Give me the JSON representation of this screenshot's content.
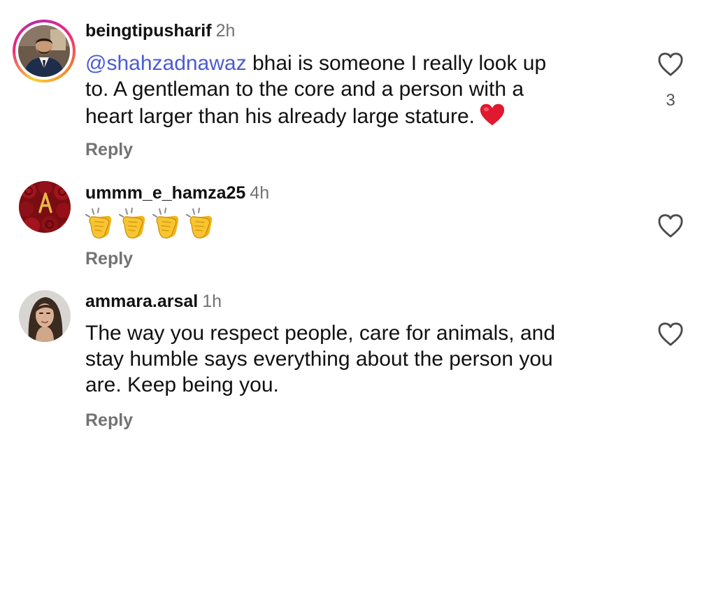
{
  "comments": [
    {
      "username": "beingtipusharif",
      "time": "2h",
      "mention": "@shahzadnawaz",
      "text_lines": [
        " bhai is someone I really look up",
        "to. A gentleman to the core and a person with a",
        "heart larger than his already large stature."
      ],
      "trailing_emoji": "red-heart",
      "reply_label": "Reply",
      "like_count": "3",
      "has_story_ring": true
    },
    {
      "username": "ummm_e_hamza25",
      "time": "4h",
      "emoji": [
        "clapping-hands",
        "clapping-hands",
        "clapping-hands",
        "clapping-hands"
      ],
      "reply_label": "Reply"
    },
    {
      "username": "ammara.arsal",
      "time": "1h",
      "text_lines": [
        "The way you respect people, care for animals, and",
        "stay humble says everything about the person you",
        "are. Keep being you."
      ],
      "reply_label": "Reply"
    }
  ],
  "icons": {
    "like": "heart-outline-icon",
    "heart_emoji_color": "#e0192e",
    "clap_emoji_color": "#f7c531"
  },
  "colors": {
    "text": "#111111",
    "secondary": "#737373",
    "mention": "#4a5bd4"
  }
}
